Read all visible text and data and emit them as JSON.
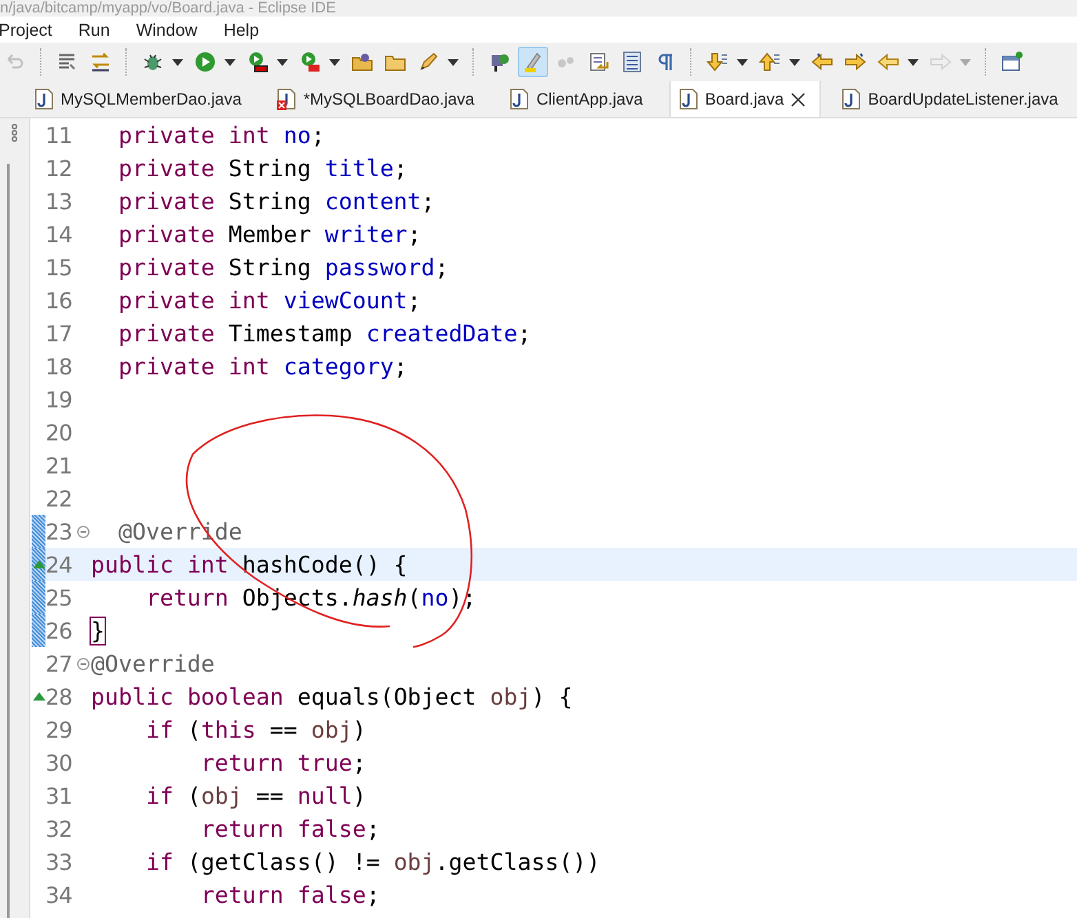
{
  "window": {
    "title": "n/java/bitcamp/myapp/vo/Board.java - Eclipse IDE"
  },
  "menu": [
    "Project",
    "Run",
    "Window",
    "Help"
  ],
  "toolbar": [
    {
      "kind": "undo",
      "dropdown": false,
      "pressed": false,
      "disabled": true
    },
    {
      "kind": "sep"
    },
    {
      "kind": "lines",
      "dropdown": false,
      "pressed": false,
      "disabled": false
    },
    {
      "kind": "swap",
      "dropdown": false,
      "pressed": false,
      "disabled": false
    },
    {
      "kind": "sep"
    },
    {
      "kind": "bug",
      "dropdown": true,
      "pressed": false,
      "disabled": false
    },
    {
      "kind": "run",
      "dropdown": true,
      "pressed": false,
      "disabled": false
    },
    {
      "kind": "coverage",
      "dropdown": true,
      "pressed": false,
      "disabled": false
    },
    {
      "kind": "tools",
      "dropdown": true,
      "pressed": false,
      "disabled": false
    },
    {
      "kind": "folder-ball",
      "dropdown": false,
      "pressed": false,
      "disabled": false
    },
    {
      "kind": "folder",
      "dropdown": false,
      "pressed": false,
      "disabled": false
    },
    {
      "kind": "pencil",
      "dropdown": true,
      "pressed": false,
      "disabled": false
    },
    {
      "kind": "sep"
    },
    {
      "kind": "hierarchy",
      "dropdown": false,
      "pressed": false,
      "disabled": false
    },
    {
      "kind": "highlighter",
      "dropdown": false,
      "pressed": true,
      "disabled": false
    },
    {
      "kind": "dots",
      "dropdown": false,
      "pressed": false,
      "disabled": true
    },
    {
      "kind": "doc-arrow",
      "dropdown": false,
      "pressed": false,
      "disabled": false
    },
    {
      "kind": "list",
      "dropdown": false,
      "pressed": false,
      "disabled": false
    },
    {
      "kind": "pilcrow",
      "dropdown": false,
      "pressed": false,
      "disabled": false
    },
    {
      "kind": "sep"
    },
    {
      "kind": "down",
      "dropdown": true,
      "pressed": false,
      "disabled": false
    },
    {
      "kind": "up",
      "dropdown": true,
      "pressed": false,
      "disabled": false
    },
    {
      "kind": "back-star",
      "dropdown": false,
      "pressed": false,
      "disabled": false
    },
    {
      "kind": "forward-star",
      "dropdown": false,
      "pressed": false,
      "disabled": false
    },
    {
      "kind": "back",
      "dropdown": true,
      "pressed": false,
      "disabled": false
    },
    {
      "kind": "forward",
      "dropdown": true,
      "pressed": false,
      "disabled": true
    },
    {
      "kind": "sep"
    },
    {
      "kind": "window-pin",
      "dropdown": false,
      "pressed": false,
      "disabled": false
    }
  ],
  "tabs": [
    {
      "label": "MySQLMemberDao.java",
      "selected": false,
      "error": false
    },
    {
      "label": "*MySQLBoardDao.java",
      "selected": false,
      "error": true
    },
    {
      "label": "ClientApp.java",
      "selected": false,
      "error": false
    },
    {
      "label": "Board.java",
      "selected": true,
      "error": false
    },
    {
      "label": "BoardUpdateListener.java",
      "selected": false,
      "error": false
    }
  ],
  "lines": [
    {
      "number": "11",
      "tokens": [
        {
          "t": "  private",
          "kind": "kw"
        },
        {
          "t": " int",
          "kind": "kw"
        },
        {
          "t": " no",
          "kind": "field"
        },
        {
          "t": ";",
          "kind": "plain"
        }
      ],
      "current": false,
      "changed": false,
      "fold": false,
      "override": false
    },
    {
      "number": "12",
      "tokens": [
        {
          "t": "  private",
          "kind": "kw"
        },
        {
          "t": " String ",
          "kind": "plain"
        },
        {
          "t": "title",
          "kind": "field"
        },
        {
          "t": ";",
          "kind": "plain"
        }
      ],
      "current": false,
      "changed": false,
      "fold": false,
      "override": false
    },
    {
      "number": "13",
      "tokens": [
        {
          "t": "  private",
          "kind": "kw"
        },
        {
          "t": " String ",
          "kind": "plain"
        },
        {
          "t": "content",
          "kind": "field"
        },
        {
          "t": ";",
          "kind": "plain"
        }
      ],
      "current": false,
      "changed": false,
      "fold": false,
      "override": false
    },
    {
      "number": "14",
      "tokens": [
        {
          "t": "  private",
          "kind": "kw"
        },
        {
          "t": " Member ",
          "kind": "plain"
        },
        {
          "t": "writer",
          "kind": "field"
        },
        {
          "t": ";",
          "kind": "plain"
        }
      ],
      "current": false,
      "changed": false,
      "fold": false,
      "override": false
    },
    {
      "number": "15",
      "tokens": [
        {
          "t": "  private",
          "kind": "kw"
        },
        {
          "t": " String ",
          "kind": "plain"
        },
        {
          "t": "password",
          "kind": "field"
        },
        {
          "t": ";",
          "kind": "plain"
        }
      ],
      "current": false,
      "changed": false,
      "fold": false,
      "override": false
    },
    {
      "number": "16",
      "tokens": [
        {
          "t": "  private",
          "kind": "kw"
        },
        {
          "t": " int",
          "kind": "kw"
        },
        {
          "t": " viewCount",
          "kind": "field"
        },
        {
          "t": ";",
          "kind": "plain"
        }
      ],
      "current": false,
      "changed": false,
      "fold": false,
      "override": false
    },
    {
      "number": "17",
      "tokens": [
        {
          "t": "  private",
          "kind": "kw"
        },
        {
          "t": " Timestamp ",
          "kind": "plain"
        },
        {
          "t": "createdDate",
          "kind": "field"
        },
        {
          "t": ";",
          "kind": "plain"
        }
      ],
      "current": false,
      "changed": false,
      "fold": false,
      "override": false
    },
    {
      "number": "18",
      "tokens": [
        {
          "t": "  private",
          "kind": "kw"
        },
        {
          "t": " int",
          "kind": "kw"
        },
        {
          "t": " category",
          "kind": "field"
        },
        {
          "t": ";",
          "kind": "plain"
        }
      ],
      "current": false,
      "changed": false,
      "fold": false,
      "override": false
    },
    {
      "number": "19",
      "current": false,
      "changed": false,
      "fold": false,
      "override": false
    },
    {
      "number": "20",
      "current": false,
      "changed": false,
      "fold": false,
      "override": false
    },
    {
      "number": "21",
      "current": false,
      "changed": false,
      "fold": false,
      "override": false
    },
    {
      "number": "22",
      "current": false,
      "changed": false,
      "fold": false,
      "override": false
    },
    {
      "number": "23",
      "tokens": [
        {
          "t": "  @Override",
          "kind": "annot"
        }
      ],
      "current": false,
      "changed": true,
      "fold": true,
      "override": false
    },
    {
      "number": "24",
      "tokens": [
        {
          "t": "public",
          "kind": "kw"
        },
        {
          "t": " int",
          "kind": "kw"
        },
        {
          "t": " hashCode() {",
          "kind": "plain"
        }
      ],
      "current": true,
      "changed": true,
      "fold": false,
      "override": true
    },
    {
      "number": "25",
      "tokens": [
        {
          "t": "    return",
          "kind": "kw"
        },
        {
          "t": " Objects.",
          "kind": "plain"
        },
        {
          "t": "hash",
          "kind": "static"
        },
        {
          "t": "(",
          "kind": "plain"
        },
        {
          "t": "no",
          "kind": "field"
        },
        {
          "t": ");",
          "kind": "plain"
        }
      ],
      "current": false,
      "changed": true,
      "fold": false,
      "override": false
    },
    {
      "number": "26",
      "tokens": [
        {
          "t": "}",
          "kind": "match"
        }
      ],
      "current": false,
      "changed": true,
      "fold": false,
      "override": false
    },
    {
      "number": "27",
      "tokens": [
        {
          "t": "@Override",
          "kind": "annot"
        }
      ],
      "current": false,
      "changed": false,
      "fold": true,
      "override": false
    },
    {
      "number": "28",
      "tokens": [
        {
          "t": "public",
          "kind": "kw"
        },
        {
          "t": " boolean",
          "kind": "kw"
        },
        {
          "t": " equals(Object ",
          "kind": "plain"
        },
        {
          "t": "obj",
          "kind": "local"
        },
        {
          "t": ") {",
          "kind": "plain"
        }
      ],
      "current": false,
      "changed": false,
      "fold": false,
      "override": true
    },
    {
      "number": "29",
      "tokens": [
        {
          "t": "    if",
          "kind": "kw"
        },
        {
          "t": " (",
          "kind": "plain"
        },
        {
          "t": "this",
          "kind": "kw"
        },
        {
          "t": " == ",
          "kind": "plain"
        },
        {
          "t": "obj",
          "kind": "local"
        },
        {
          "t": ")",
          "kind": "plain"
        }
      ],
      "current": false,
      "changed": false,
      "fold": false,
      "override": false
    },
    {
      "number": "30",
      "tokens": [
        {
          "t": "        return",
          "kind": "kw"
        },
        {
          "t": " true",
          "kind": "kw"
        },
        {
          "t": ";",
          "kind": "plain"
        }
      ],
      "current": false,
      "changed": false,
      "fold": false,
      "override": false
    },
    {
      "number": "31",
      "tokens": [
        {
          "t": "    if",
          "kind": "kw"
        },
        {
          "t": " (",
          "kind": "plain"
        },
        {
          "t": "obj",
          "kind": "local"
        },
        {
          "t": " == ",
          "kind": "plain"
        },
        {
          "t": "null",
          "kind": "kw"
        },
        {
          "t": ")",
          "kind": "plain"
        }
      ],
      "current": false,
      "changed": false,
      "fold": false,
      "override": false
    },
    {
      "number": "32",
      "tokens": [
        {
          "t": "        return",
          "kind": "kw"
        },
        {
          "t": " false",
          "kind": "kw"
        },
        {
          "t": ";",
          "kind": "plain"
        }
      ],
      "current": false,
      "changed": false,
      "fold": false,
      "override": false
    },
    {
      "number": "33",
      "tokens": [
        {
          "t": "    if",
          "kind": "kw"
        },
        {
          "t": " (getClass() != ",
          "kind": "plain"
        },
        {
          "t": "obj",
          "kind": "local"
        },
        {
          "t": ".getClass())",
          "kind": "plain"
        }
      ],
      "current": false,
      "changed": false,
      "fold": false,
      "override": false
    },
    {
      "number": "34",
      "tokens": [
        {
          "t": "        return",
          "kind": "kw"
        },
        {
          "t": " false",
          "kind": "kw"
        },
        {
          "t": ";",
          "kind": "plain"
        }
      ],
      "current": false,
      "changed": false,
      "fold": false,
      "override": false
    }
  ]
}
